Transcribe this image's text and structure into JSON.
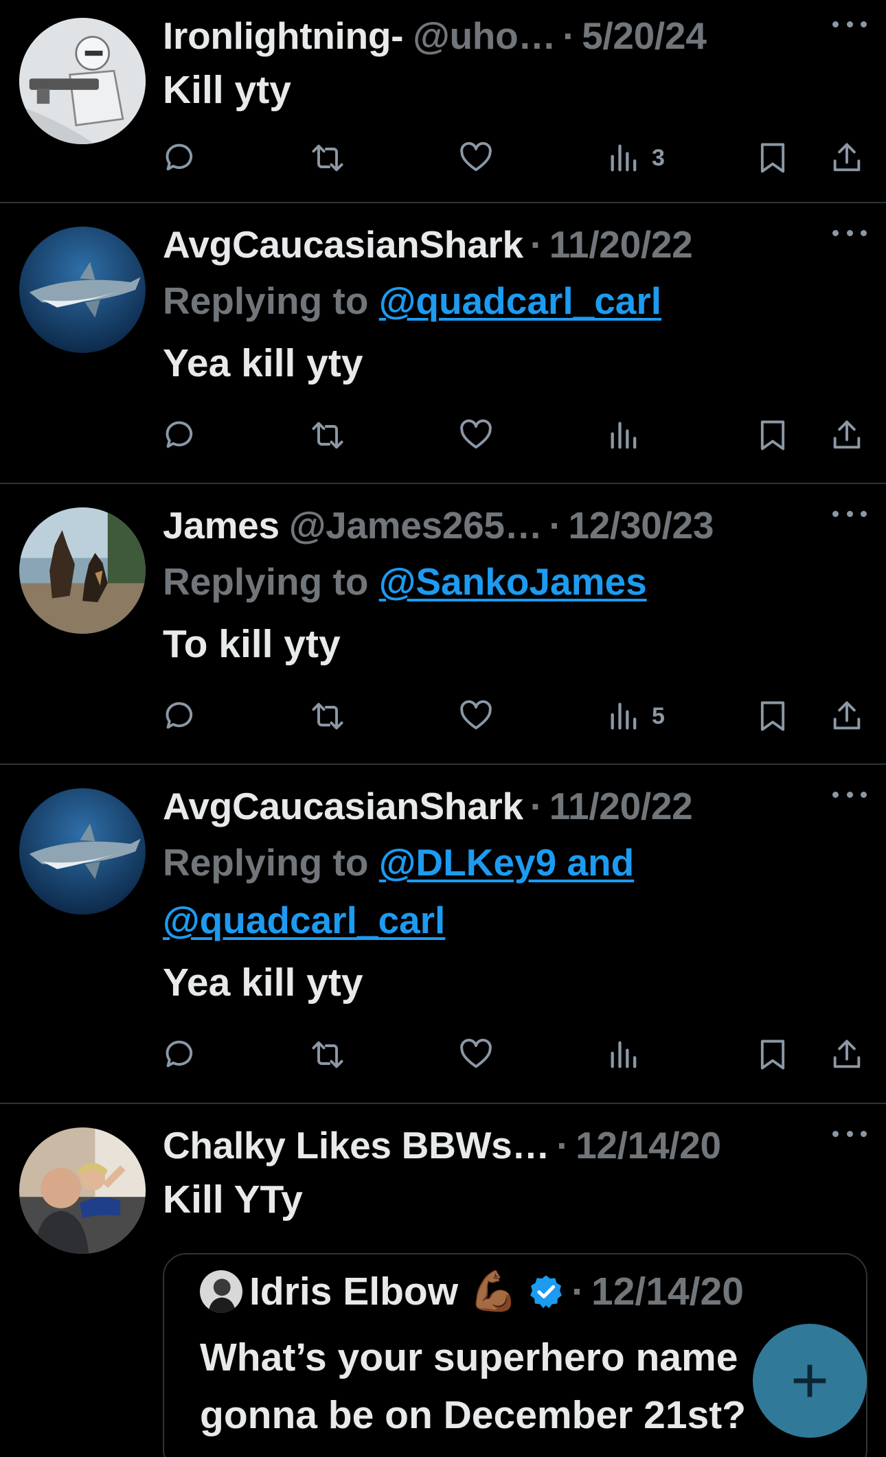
{
  "colors": {
    "background": "#000000",
    "text": "#e7e9ea",
    "muted": "#71767b",
    "link": "#1d9bf0",
    "fab": "#3f9bc4"
  },
  "posts": [
    {
      "name": "Ironlightning-",
      "handle": "@uho…",
      "dot": "·",
      "date": "5/20/24",
      "text": "Kill yty",
      "views": "3",
      "avatar_icon": "robot-soldier-avatar"
    },
    {
      "name": "AvgCaucasianShark",
      "dot": "·",
      "date": "11/20/22",
      "replying_label": "Replying to",
      "replying_to": "@quadcarl_carl",
      "text": "Yea kill yty",
      "views": "",
      "avatar_icon": "shark-avatar"
    },
    {
      "name": "James",
      "handle": "@James265…",
      "dot": "·",
      "date": "12/30/23",
      "replying_label": "Replying to",
      "replying_to": "@SankoJames",
      "text": "To kill yty",
      "views": "5",
      "avatar_icon": "dogs-avatar"
    },
    {
      "name": "AvgCaucasianShark",
      "dot": "·",
      "date": "11/20/22",
      "replying_label": "Replying to",
      "replying_to": "@DLKey9 and",
      "replying_to_2": "@quadcarl_carl",
      "text": "Yea kill yty",
      "views": "",
      "avatar_icon": "shark-avatar"
    },
    {
      "name": "Chalky Likes BBWs…",
      "dot": "·",
      "date": "12/14/20",
      "text": "Kill YTy",
      "avatar_icon": "selfie-avatar"
    }
  ],
  "quote": {
    "name": "Idris Elbow",
    "emoji": "💪🏾",
    "dot": "·",
    "date": "12/14/20",
    "line1": "What’s your superhero name",
    "line2": "gonna be on December 21st?"
  },
  "fab": {
    "label": "+"
  }
}
